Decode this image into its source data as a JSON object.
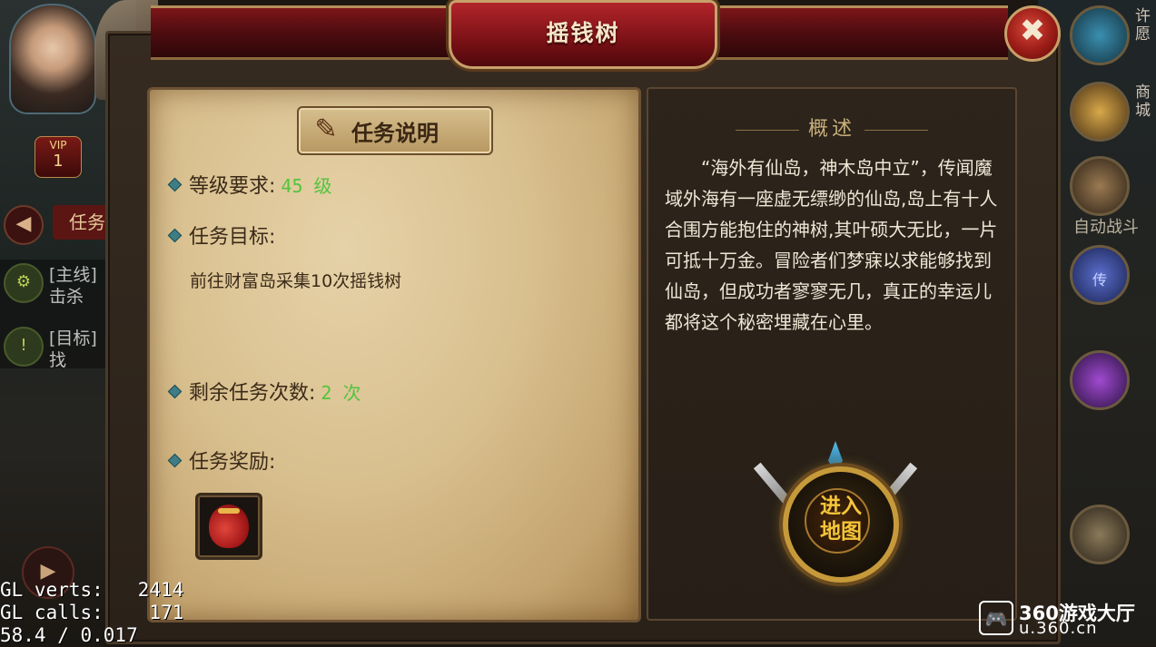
{
  "window": {
    "title": "摇钱树",
    "close_icon": "✖"
  },
  "task_panel": {
    "section_title": "任务说明",
    "level_label": "等级要求:",
    "level_value": "45 级",
    "goal_label": "任务目标:",
    "goal_text": "前往财富岛采集10次摇钱树",
    "remaining_label": "剩余任务次数:",
    "remaining_value": "2 次",
    "reward_label": "任务奖励:",
    "reward_item_icon": "money-bag-icon"
  },
  "description": {
    "heading": "概述",
    "text": "“海外有仙岛，神木岛中立”，传闻魔域外海有一座虚无缥缈的仙岛,岛上有十人合围方能抱住的神树,其叶硕大无比，一片可抵十万金。冒险者们梦寐以求能够找到仙岛，但成功者寥寥无几，真正的幸运儿都将这个秘密埋藏在心里。"
  },
  "enter_button": {
    "line1": "进入",
    "line2": "地图"
  },
  "background": {
    "vip_label": "VIP",
    "vip_level": "1",
    "task_tab": "任务",
    "track_main_1": "[主线]",
    "track_main_2": "击杀",
    "track_target_1": "[目标]",
    "track_target_2": "找",
    "right_wish": "许愿",
    "right_shop": "商城",
    "right_auto_battle": "自动战斗",
    "right_teleport": "传"
  },
  "debug_overlay": {
    "line1": "GL verts:   2414",
    "line2": "GL calls:    171",
    "line3": "58.4 / 0.017"
  },
  "watermark": {
    "title": "360游戏大厅",
    "sub": "u.360.cn"
  },
  "colors": {
    "accent_green": "#53c43c",
    "title_red": "#7c1518",
    "gold": "#f4c53a"
  }
}
